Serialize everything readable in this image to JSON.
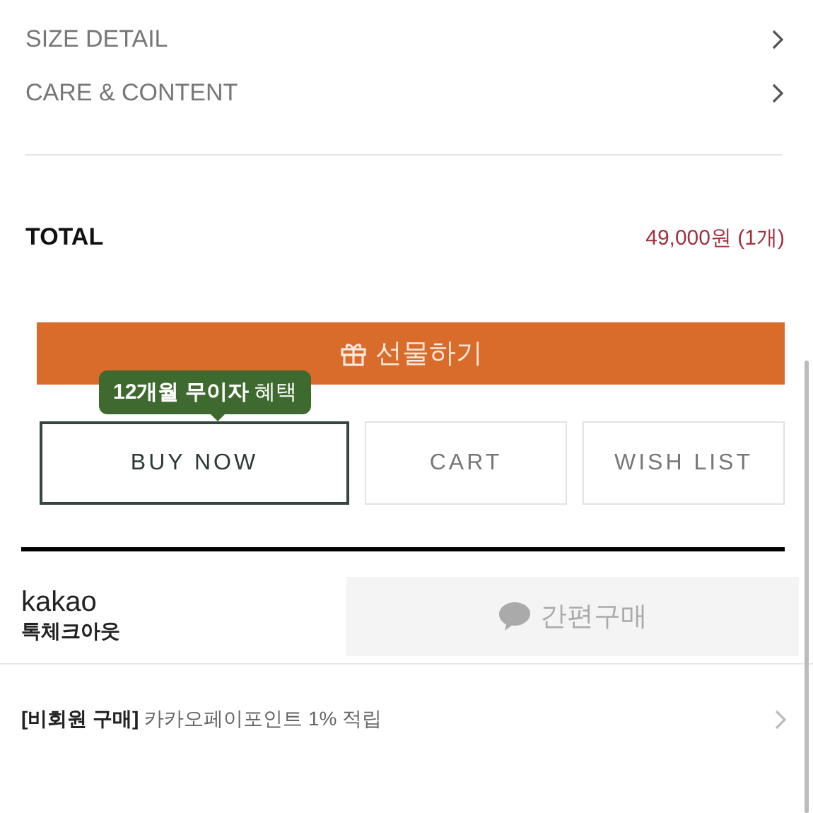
{
  "info_links": [
    {
      "label": "SIZE DETAIL"
    },
    {
      "label": "CARE & CONTENT"
    }
  ],
  "total": {
    "label": "TOTAL",
    "amount": "49,000원 (1개)"
  },
  "gift_button": {
    "label": "선물하기"
  },
  "promo_tooltip": "**12개월 무이자** 혜택",
  "actions": [
    {
      "label": "BUY NOW",
      "kind": "primary"
    },
    {
      "label": "CART",
      "kind": "secondary"
    },
    {
      "label": "WISH LIST",
      "kind": "secondary"
    }
  ],
  "kakao": {
    "brand": "kakao",
    "subtitle": "톡체크아웃",
    "button": "간편구매",
    "disabled": true
  },
  "benefit_row": "**[비회원 구매]** 카카오페이포인트 1% 적립"
}
